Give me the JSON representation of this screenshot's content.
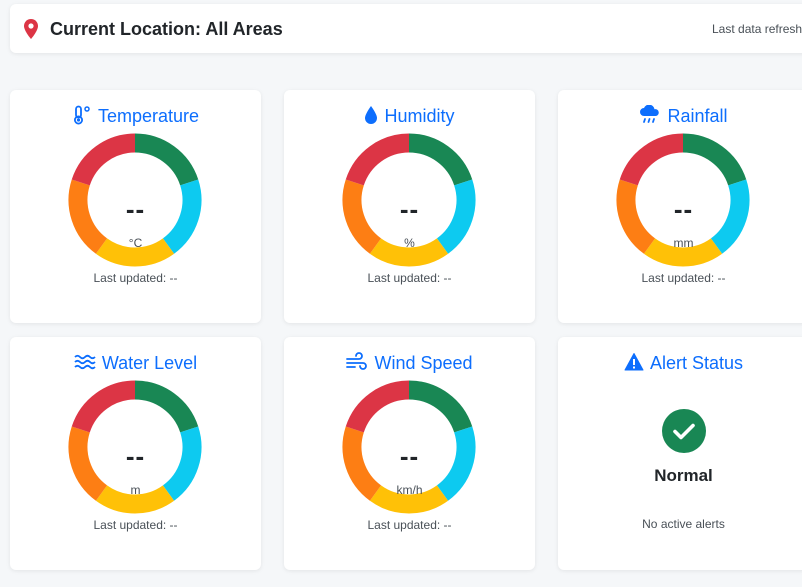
{
  "header": {
    "location_title": "Current Location: All Areas",
    "refresh_label": "Last data refresh:",
    "icon": "map-marker-icon"
  },
  "gauge_colors": [
    "#198754",
    "#0dcaf0",
    "#ffc107",
    "#fd7e14",
    "#dc3545"
  ],
  "cards": [
    {
      "title": "Temperature",
      "icon": "thermometer-icon",
      "value": "--",
      "unit": "°C",
      "last_updated": "Last updated: --"
    },
    {
      "title": "Humidity",
      "icon": "water-drop-icon",
      "value": "--",
      "unit": "%",
      "last_updated": "Last updated: --"
    },
    {
      "title": "Rainfall",
      "icon": "cloud-rain-icon",
      "value": "--",
      "unit": "mm",
      "last_updated": "Last updated: --"
    },
    {
      "title": "Water Level",
      "icon": "water-waves-icon",
      "value": "--",
      "unit": "m",
      "last_updated": "Last updated: --"
    },
    {
      "title": "Wind Speed",
      "icon": "wind-icon",
      "value": "--",
      "unit": "km/h",
      "last_updated": "Last updated: --"
    }
  ],
  "alert": {
    "title": "Alert Status",
    "icon": "warning-triangle-icon",
    "status_icon": "check-icon",
    "status": "Normal",
    "note": "No active alerts",
    "color": "#198754"
  }
}
